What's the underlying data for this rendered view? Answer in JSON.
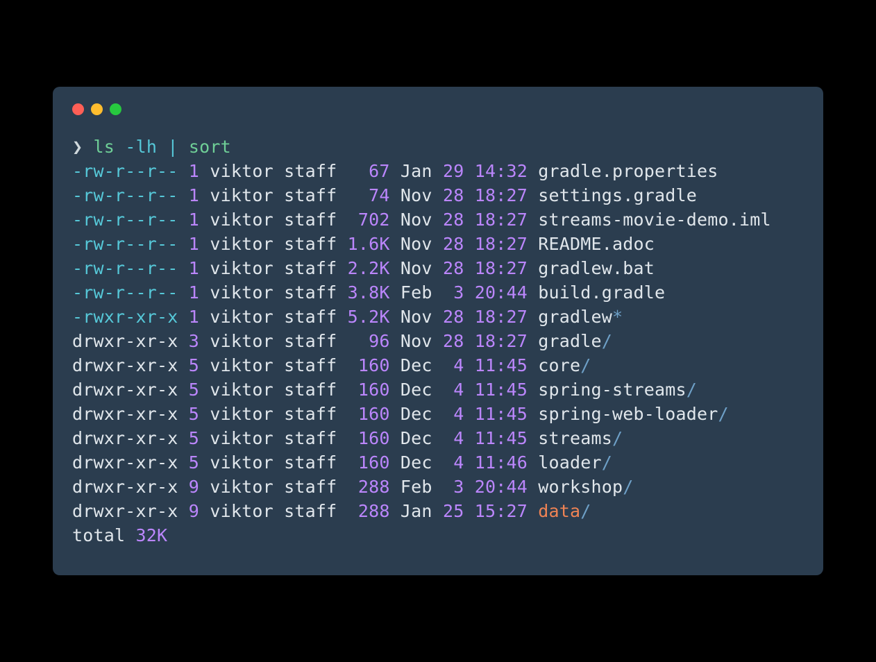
{
  "prompt": {
    "arrow": "❯",
    "cmd1": "ls",
    "flag": "-lh",
    "pipe": "|",
    "cmd2": "sort"
  },
  "rows": [
    {
      "perms": "-rw-r--r--",
      "links": "1",
      "user": "viktor",
      "group": "staff",
      "size": "  67",
      "month": "Jan",
      "day": "29",
      "time": "14:32",
      "name": "gradle.properties",
      "type": "file"
    },
    {
      "perms": "-rw-r--r--",
      "links": "1",
      "user": "viktor",
      "group": "staff",
      "size": "  74",
      "month": "Nov",
      "day": "28",
      "time": "18:27",
      "name": "settings.gradle",
      "type": "file"
    },
    {
      "perms": "-rw-r--r--",
      "links": "1",
      "user": "viktor",
      "group": "staff",
      "size": " 702",
      "month": "Nov",
      "day": "28",
      "time": "18:27",
      "name": "streams-movie-demo.iml",
      "type": "file"
    },
    {
      "perms": "-rw-r--r--",
      "links": "1",
      "user": "viktor",
      "group": "staff",
      "size": "1.6K",
      "month": "Nov",
      "day": "28",
      "time": "18:27",
      "name": "README.adoc",
      "type": "file"
    },
    {
      "perms": "-rw-r--r--",
      "links": "1",
      "user": "viktor",
      "group": "staff",
      "size": "2.2K",
      "month": "Nov",
      "day": "28",
      "time": "18:27",
      "name": "gradlew.bat",
      "type": "file"
    },
    {
      "perms": "-rw-r--r--",
      "links": "1",
      "user": "viktor",
      "group": "staff",
      "size": "3.8K",
      "month": "Feb",
      "day": " 3",
      "time": "20:44",
      "name": "build.gradle",
      "type": "file"
    },
    {
      "perms": "-rwxr-xr-x",
      "links": "1",
      "user": "viktor",
      "group": "staff",
      "size": "5.2K",
      "month": "Nov",
      "day": "28",
      "time": "18:27",
      "name": "gradlew",
      "type": "exec"
    },
    {
      "perms": "drwxr-xr-x",
      "links": "3",
      "user": "viktor",
      "group": "staff",
      "size": "  96",
      "month": "Nov",
      "day": "28",
      "time": "18:27",
      "name": "gradle",
      "type": "dir"
    },
    {
      "perms": "drwxr-xr-x",
      "links": "5",
      "user": "viktor",
      "group": "staff",
      "size": " 160",
      "month": "Dec",
      "day": " 4",
      "time": "11:45",
      "name": "core",
      "type": "dir"
    },
    {
      "perms": "drwxr-xr-x",
      "links": "5",
      "user": "viktor",
      "group": "staff",
      "size": " 160",
      "month": "Dec",
      "day": " 4",
      "time": "11:45",
      "name": "spring-streams",
      "type": "dir"
    },
    {
      "perms": "drwxr-xr-x",
      "links": "5",
      "user": "viktor",
      "group": "staff",
      "size": " 160",
      "month": "Dec",
      "day": " 4",
      "time": "11:45",
      "name": "spring-web-loader",
      "type": "dir"
    },
    {
      "perms": "drwxr-xr-x",
      "links": "5",
      "user": "viktor",
      "group": "staff",
      "size": " 160",
      "month": "Dec",
      "day": " 4",
      "time": "11:45",
      "name": "streams",
      "type": "dir"
    },
    {
      "perms": "drwxr-xr-x",
      "links": "5",
      "user": "viktor",
      "group": "staff",
      "size": " 160",
      "month": "Dec",
      "day": " 4",
      "time": "11:46",
      "name": "loader",
      "type": "dir"
    },
    {
      "perms": "drwxr-xr-x",
      "links": "9",
      "user": "viktor",
      "group": "staff",
      "size": " 288",
      "month": "Feb",
      "day": " 3",
      "time": "20:44",
      "name": "workshop",
      "type": "dir"
    },
    {
      "perms": "drwxr-xr-x",
      "links": "9",
      "user": "viktor",
      "group": "staff",
      "size": " 288",
      "month": "Jan",
      "day": "25",
      "time": "15:27",
      "name": "data",
      "type": "special-dir"
    }
  ],
  "total": {
    "label": "total",
    "value": "32K"
  }
}
